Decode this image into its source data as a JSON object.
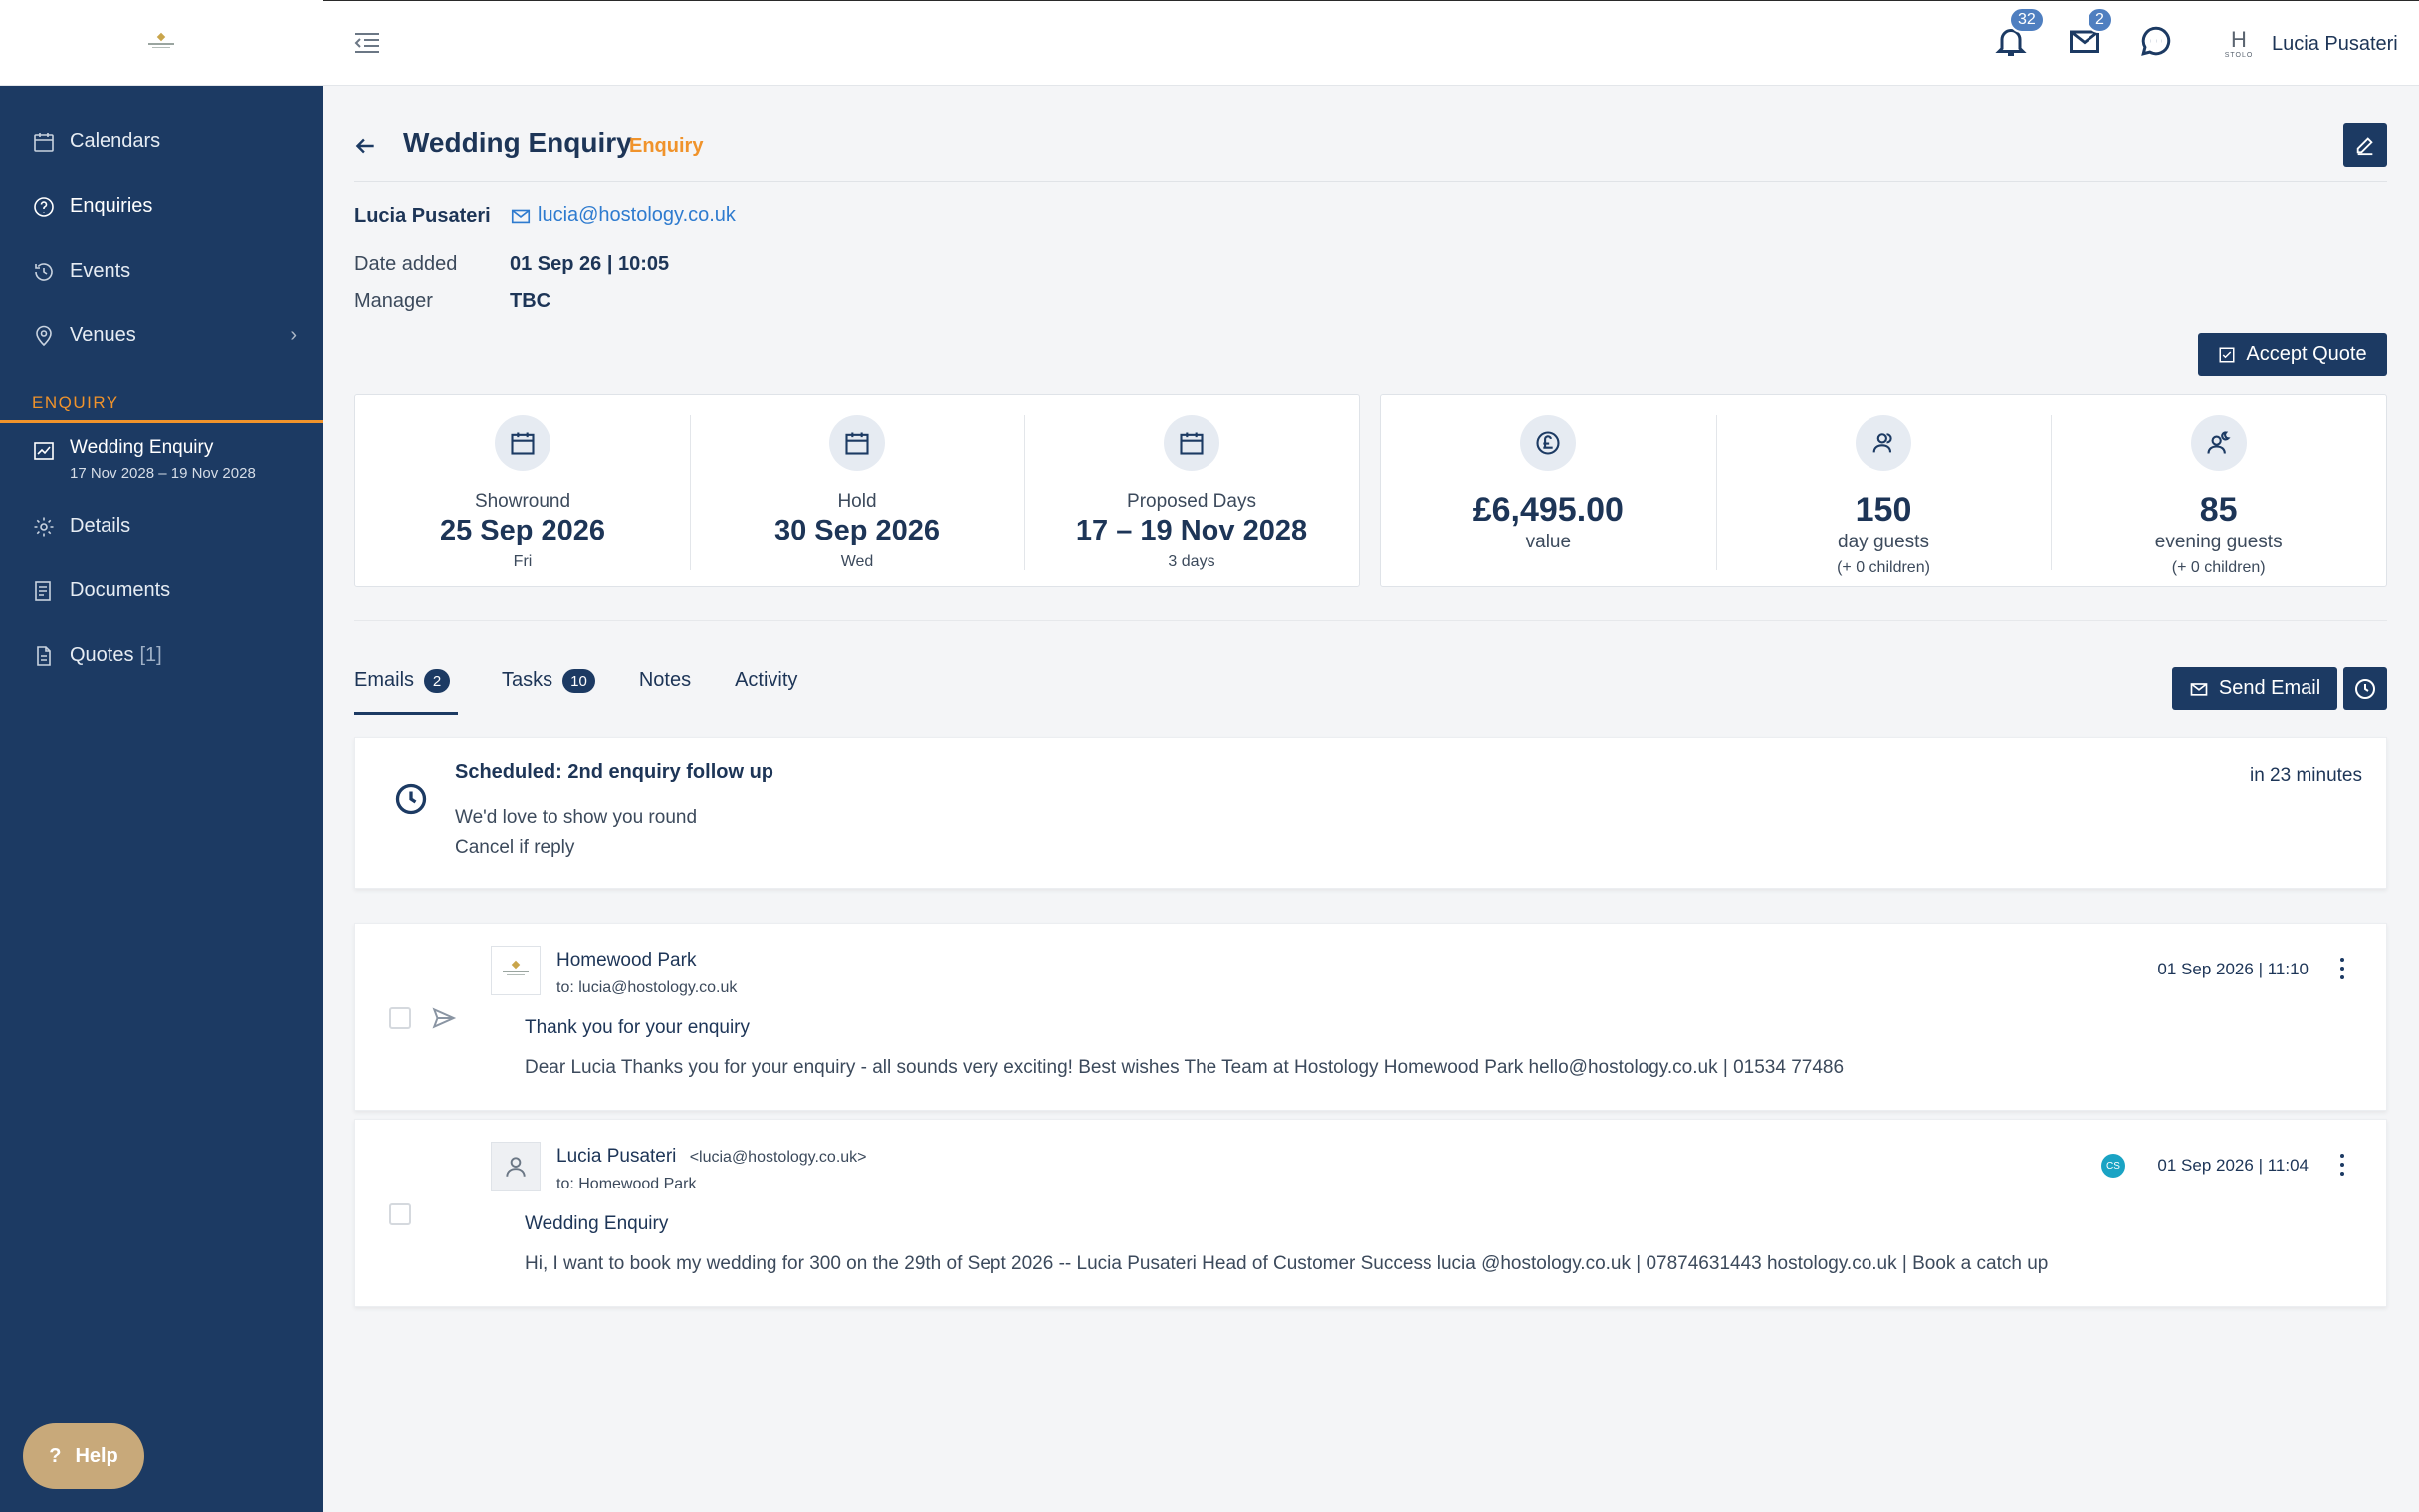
{
  "header": {
    "notifications_count": "32",
    "messages_count": "2",
    "brand_letter": "H",
    "brand_sub": "STOLO",
    "user_name": "Lucia Pusateri"
  },
  "sidebar": {
    "items": [
      {
        "label": "Calendars",
        "icon": "calendar-icon"
      },
      {
        "label": "Enquiries",
        "icon": "question-circle-icon"
      },
      {
        "label": "Events",
        "icon": "history-icon"
      },
      {
        "label": "Venues",
        "icon": "location-pin-icon"
      }
    ],
    "venues_chevron": "›",
    "section_label": "ENQUIRY",
    "current": {
      "title": "Wedding Enquiry",
      "dates": "17 Nov 2028 – 19 Nov 2028",
      "icon": "chart-line-icon"
    },
    "sub_items": [
      {
        "label": "Details",
        "icon": "gear-icon"
      },
      {
        "label": "Documents",
        "icon": "document-icon"
      },
      {
        "label": "Quotes",
        "count": "[1]",
        "icon": "file-icon"
      }
    ],
    "help_label": "Help",
    "help_glyph": "?"
  },
  "page": {
    "title": "Wedding Enquiry",
    "status": "Enquiry",
    "contact_name": "Lucia Pusateri",
    "contact_email": "lucia@hostology.co.uk",
    "date_added_label": "Date added",
    "date_added_value": "01 Sep 26 | 10:05",
    "manager_label": "Manager",
    "manager_value": "TBC",
    "accept_quote_label": "Accept Quote"
  },
  "dates_card": [
    {
      "label": "Showround",
      "value": "25 Sep 2026",
      "sub": "Fri"
    },
    {
      "label": "Hold",
      "value": "30 Sep 2026",
      "sub": "Wed"
    },
    {
      "label": "Proposed Days",
      "value": "17 – 19 Nov 2028",
      "sub": "3 days"
    }
  ],
  "figures_card": [
    {
      "value": "£6,495.00",
      "label": "value",
      "sub": "",
      "icon": "pound-circle-icon"
    },
    {
      "value": "150",
      "label": "day guests",
      "sub": "(+ 0 children)",
      "icon": "people-icon"
    },
    {
      "value": "85",
      "label": "evening guests",
      "sub": "(+ 0 children)",
      "icon": "evening-people-icon"
    }
  ],
  "tabs": [
    {
      "label": "Emails",
      "count": "2"
    },
    {
      "label": "Tasks",
      "count": "10"
    },
    {
      "label": "Notes"
    },
    {
      "label": "Activity"
    }
  ],
  "send_email_label": "Send Email",
  "scheduled": {
    "title": "Scheduled: 2nd enquiry follow up",
    "line1": "We'd love to show you round",
    "line2": "Cancel if reply",
    "when": "in 23 minutes"
  },
  "emails": [
    {
      "sender": "Homewood Park",
      "sender_addr": "",
      "to": "to: lucia@hostology.co.uk",
      "subject": "Thank you for your enquiry",
      "snippet": "Dear Lucia Thanks you for your enquiry - all sounds very exciting! Best wishes The Team at Hostology Homewood Park hello@hostology.co.uk | 01534 77486",
      "time": "01 Sep 2026 | 11:10"
    },
    {
      "sender": "Lucia Pusateri",
      "sender_addr": "<lucia@hostology.co.uk>",
      "to": "to: Homewood Park",
      "subject": "Wedding Enquiry",
      "snippet": "Hi, I want to book my wedding for 300 on the 29th of Sept 2026 -- Lucia Pusateri Head of Customer Success lucia @hostology.co.uk | 07874631443 hostology.co.uk | Book a catch up",
      "time": "01 Sep 2026 | 11:04",
      "assignee_initials": "CS"
    }
  ],
  "colors": {
    "sidebar": "#1c3a63",
    "accent": "#f0932b",
    "link": "#2e7bcf",
    "badge": "#4f7fc0",
    "help": "#c8a97a"
  }
}
